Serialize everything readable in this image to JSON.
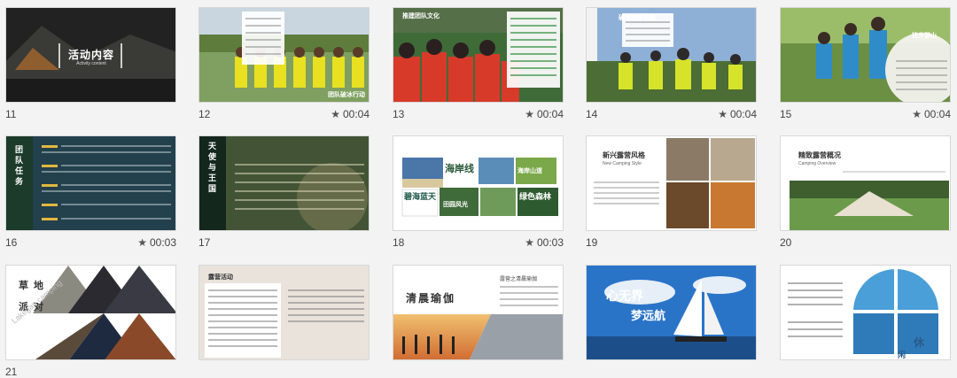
{
  "slides": [
    {
      "number": "11",
      "duration": "",
      "title": "活动内容",
      "subtitle": "Activity content"
    },
    {
      "number": "12",
      "duration": "00:04",
      "caption": "团队破冰行动"
    },
    {
      "number": "13",
      "duration": "00:04",
      "caption": "推建团队文化"
    },
    {
      "number": "14",
      "duration": "00:04",
      "caption": "破冰热身拓展"
    },
    {
      "number": "15",
      "duration": "00:04",
      "caption": "徒步游山"
    },
    {
      "number": "16",
      "duration": "00:03",
      "side_title": "团队任务"
    },
    {
      "number": "17",
      "duration": "",
      "side_title": "天使与王国"
    },
    {
      "number": "18",
      "duration": "00:03",
      "title": "海岸线",
      "tiles": [
        "碧海蓝天",
        "绿色森林",
        "海岸山道",
        "田园风光"
      ]
    },
    {
      "number": "19",
      "duration": "",
      "title": "新兴露营风格",
      "subtitle": "New Camping Style"
    },
    {
      "number": "20",
      "duration": "",
      "title": "精致露营概况",
      "subtitle": "Camping Overview"
    },
    {
      "number": "21",
      "duration": "",
      "title_a": "草地",
      "title_b": "派对",
      "watermark": "Lakegan camping"
    },
    {
      "number": "22",
      "duration": "00:03",
      "title": "露营活动"
    },
    {
      "number": "23",
      "duration": "",
      "title": "清晨瑜伽",
      "caption": "露营之清晨瑜伽"
    },
    {
      "number": "24",
      "duration": "",
      "title_a": "心无界",
      "title_b": "梦远航"
    },
    {
      "number": "25",
      "duration": "",
      "title_a": "休",
      "title_b": "闲"
    }
  ],
  "icons": {
    "duration": "star-icon"
  }
}
